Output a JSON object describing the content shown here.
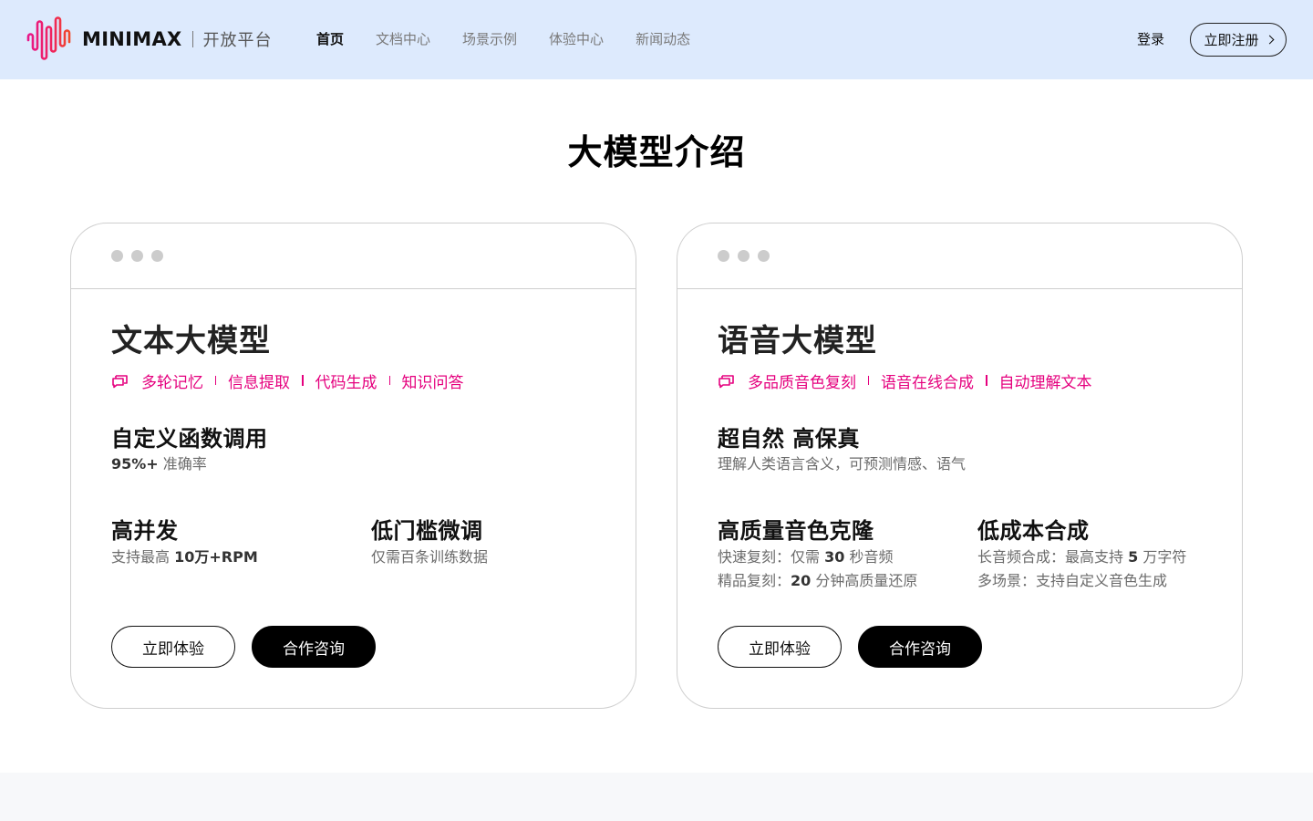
{
  "header": {
    "logo_word": "MINIMAX",
    "logo_sub": "开放平台",
    "nav": [
      {
        "label": "首页",
        "active": true
      },
      {
        "label": "文档中心",
        "active": false
      },
      {
        "label": "场景示例",
        "active": false
      },
      {
        "label": "体验中心",
        "active": false
      },
      {
        "label": "新闻动态",
        "active": false
      }
    ],
    "login": "登录",
    "register": "立即注册"
  },
  "page_title": "大模型介绍",
  "cards": [
    {
      "title": "文本大模型",
      "tags": [
        "多轮记忆",
        "信息提取",
        "代码生成",
        "知识问答"
      ],
      "feature_main": {
        "title": "自定义函数调用",
        "desc_bold": "95%+",
        "desc_rest": " 准确率"
      },
      "feature_a": {
        "title": "高并发",
        "desc_pre": "支持最高 ",
        "desc_bold": "10万+RPM"
      },
      "feature_b": {
        "title": "低门槛微调",
        "desc": "仅需百条训练数据"
      },
      "btn_try": "立即体验",
      "btn_contact": "合作咨询"
    },
    {
      "title": "语音大模型",
      "tags": [
        "多品质音色复刻",
        "语音在线合成",
        "自动理解文本"
      ],
      "feature_main": {
        "title": "超自然 高保真",
        "desc": "理解人类语言含义，可预测情感、语气"
      },
      "feature_a": {
        "title": "高质量音色克隆",
        "line1_pre": "快速复刻：仅需 ",
        "line1_bold": "30",
        "line1_post": " 秒音频",
        "line2_pre": "精品复刻：",
        "line2_bold": "20",
        "line2_post": " 分钟高质量还原"
      },
      "feature_b": {
        "title": "低成本合成",
        "line1_pre": "长音频合成：最高支持 ",
        "line1_bold": "5",
        "line1_post": " 万字符",
        "line2": "多场景：支持自定义音色生成"
      },
      "btn_try": "立即体验",
      "btn_contact": "合作咨询"
    }
  ],
  "colors": {
    "accent": "#e5007e",
    "header_bg": "#ddeafd",
    "footer_bg": "#f7f8fa"
  },
  "icons": {
    "logo": "soundwave-logo-icon",
    "tag": "chat-bubble-icon",
    "register": "chevron-right-icon",
    "window_dots": "window-dots-icon"
  }
}
